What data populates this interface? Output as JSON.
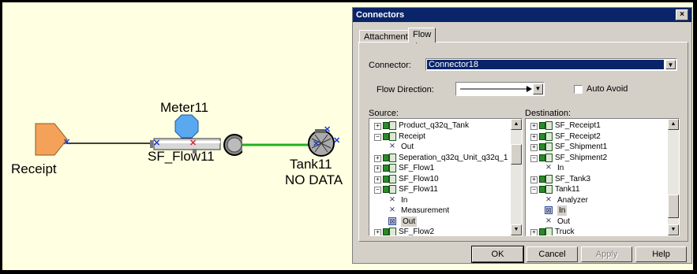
{
  "canvas": {
    "nodes": {
      "receipt_label": "Receipt",
      "meter_label": "Meter11",
      "sf_flow_label": "SF_Flow11",
      "tank_label": "Tank11",
      "tank_status": "NO DATA"
    },
    "colors": {
      "background": "#ffffe1",
      "flow_line": "#1fb01f",
      "receipt": "#f4a25a",
      "meter": "#5aa9f0"
    }
  },
  "dialog": {
    "title": "Connectors",
    "close_glyph": "×",
    "tabs": [
      {
        "label": "Attachments"
      },
      {
        "label": "Flow"
      }
    ],
    "active_tab": "Flow",
    "connector_label": "Connector:",
    "connector_value": "Connector18",
    "flow_direction_label": "Flow Direction:",
    "auto_avoid_label": "Auto Avoid",
    "auto_avoid_checked": false,
    "source_label": "Source:",
    "destination_label": "Destination:",
    "source_items": [
      {
        "text": "Product_q32q_Tank",
        "type": "node",
        "expander": "+"
      },
      {
        "text": "Receipt",
        "type": "node",
        "expander": "−"
      },
      {
        "text": "Out",
        "type": "pin"
      },
      {
        "text": "Seperation_q32q_Unit_q32q_1",
        "type": "node",
        "expander": "+"
      },
      {
        "text": "SF_Flow1",
        "type": "node",
        "expander": "+"
      },
      {
        "text": "SF_Flow10",
        "type": "node",
        "expander": "+"
      },
      {
        "text": "SF_Flow11",
        "type": "node",
        "expander": "−"
      },
      {
        "text": "In",
        "type": "pin"
      },
      {
        "text": "Measurement",
        "type": "pin"
      },
      {
        "text": "Out",
        "type": "pin",
        "selected": true
      },
      {
        "text": "SF_Flow2",
        "type": "node",
        "expander": "+"
      }
    ],
    "destination_items": [
      {
        "text": "SF_Receipt1",
        "type": "node",
        "expander": "+"
      },
      {
        "text": "SF_Receipt2",
        "type": "node",
        "expander": "+"
      },
      {
        "text": "SF_Shipment1",
        "type": "node",
        "expander": "+"
      },
      {
        "text": "SF_Shipment2",
        "type": "node",
        "expander": "−"
      },
      {
        "text": "In",
        "type": "pin"
      },
      {
        "text": "SF_Tank3",
        "type": "node",
        "expander": "+"
      },
      {
        "text": "Tank11",
        "type": "node",
        "expander": "−"
      },
      {
        "text": "Analyzer",
        "type": "pin"
      },
      {
        "text": "In",
        "type": "pin",
        "selected": true
      },
      {
        "text": "Out",
        "type": "pin"
      },
      {
        "text": "Truck",
        "type": "node",
        "expander": "+"
      }
    ],
    "buttons": {
      "ok": "OK",
      "cancel": "Cancel",
      "apply": "Apply",
      "help": "Help"
    }
  }
}
